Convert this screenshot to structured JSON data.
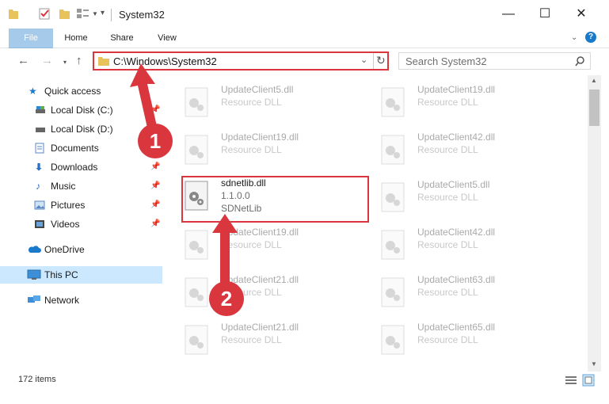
{
  "window": {
    "title": "System32"
  },
  "ribbon": {
    "tabs": [
      "File",
      "Home",
      "Share",
      "View"
    ]
  },
  "address": {
    "path": "C:\\Windows\\System32"
  },
  "search": {
    "placeholder": "Search System32"
  },
  "sidebar": {
    "items": [
      {
        "label": "Quick access",
        "icon": "star-icon"
      },
      {
        "label": "Local Disk (C:)",
        "icon": "drive-icon"
      },
      {
        "label": "Local Disk (D:)",
        "icon": "drive-icon"
      },
      {
        "label": "Documents",
        "icon": "documents-icon"
      },
      {
        "label": "Downloads",
        "icon": "download-icon"
      },
      {
        "label": "Music",
        "icon": "music-icon"
      },
      {
        "label": "Pictures",
        "icon": "pictures-icon"
      },
      {
        "label": "Videos",
        "icon": "videos-icon"
      },
      {
        "label": "OneDrive",
        "icon": "cloud-icon"
      },
      {
        "label": "This PC",
        "icon": "computer-icon"
      },
      {
        "label": "Network",
        "icon": "network-icon"
      }
    ]
  },
  "files": [
    {
      "name": "UpdateClient5.dll",
      "type": "Resource DLL"
    },
    {
      "name": "UpdateClient19.dll",
      "type": "Resource DLL"
    },
    {
      "name": "UpdateClient19.dll",
      "type": "Resource DLL"
    },
    {
      "name": "UpdateClient42.dll",
      "type": "Resource DLL"
    },
    {
      "name": "sdnetlib.dll",
      "version": "1.1.0.0",
      "desc": "SDNetLib"
    },
    {
      "name": "UpdateClient5.dll",
      "type": "Resource DLL"
    },
    {
      "name": "UpdateClient19.dll",
      "type": "Resource DLL"
    },
    {
      "name": "UpdateClient42.dll",
      "type": "Resource DLL"
    },
    {
      "name": "UpdateClient21.dll",
      "type": "Resource DLL"
    },
    {
      "name": "UpdateClient63.dll",
      "type": "Resource DLL"
    },
    {
      "name": "UpdateClient21.dll",
      "type": "Resource DLL"
    },
    {
      "name": "UpdateClient65.dll",
      "type": "Resource DLL"
    }
  ],
  "status": {
    "item_count": "172 items"
  },
  "annotations": {
    "step1": "1",
    "step2": "2"
  },
  "colors": {
    "accent": "#1979ca",
    "highlight": "#d9363e",
    "selection": "#cce8ff"
  }
}
